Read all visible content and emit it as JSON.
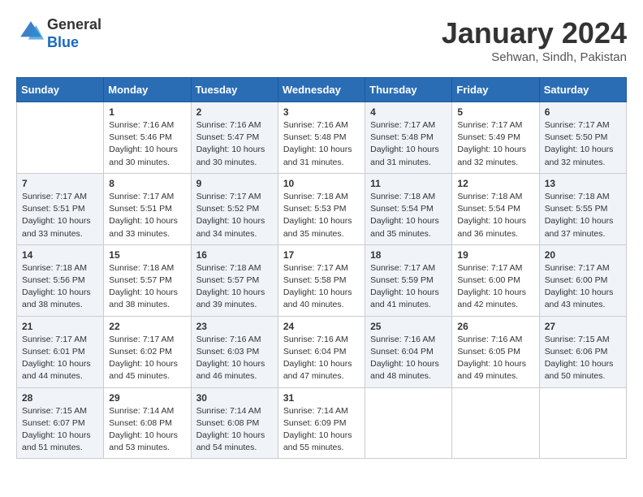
{
  "header": {
    "logo_general": "General",
    "logo_blue": "Blue",
    "month_year": "January 2024",
    "location": "Sehwan, Sindh, Pakistan"
  },
  "days_of_week": [
    "Sunday",
    "Monday",
    "Tuesday",
    "Wednesday",
    "Thursday",
    "Friday",
    "Saturday"
  ],
  "weeks": [
    [
      {
        "day": "",
        "info": ""
      },
      {
        "day": "1",
        "info": "Sunrise: 7:16 AM\nSunset: 5:46 PM\nDaylight: 10 hours\nand 30 minutes."
      },
      {
        "day": "2",
        "info": "Sunrise: 7:16 AM\nSunset: 5:47 PM\nDaylight: 10 hours\nand 30 minutes."
      },
      {
        "day": "3",
        "info": "Sunrise: 7:16 AM\nSunset: 5:48 PM\nDaylight: 10 hours\nand 31 minutes."
      },
      {
        "day": "4",
        "info": "Sunrise: 7:17 AM\nSunset: 5:48 PM\nDaylight: 10 hours\nand 31 minutes."
      },
      {
        "day": "5",
        "info": "Sunrise: 7:17 AM\nSunset: 5:49 PM\nDaylight: 10 hours\nand 32 minutes."
      },
      {
        "day": "6",
        "info": "Sunrise: 7:17 AM\nSunset: 5:50 PM\nDaylight: 10 hours\nand 32 minutes."
      }
    ],
    [
      {
        "day": "7",
        "info": "Sunrise: 7:17 AM\nSunset: 5:51 PM\nDaylight: 10 hours\nand 33 minutes."
      },
      {
        "day": "8",
        "info": "Sunrise: 7:17 AM\nSunset: 5:51 PM\nDaylight: 10 hours\nand 33 minutes."
      },
      {
        "day": "9",
        "info": "Sunrise: 7:17 AM\nSunset: 5:52 PM\nDaylight: 10 hours\nand 34 minutes."
      },
      {
        "day": "10",
        "info": "Sunrise: 7:18 AM\nSunset: 5:53 PM\nDaylight: 10 hours\nand 35 minutes."
      },
      {
        "day": "11",
        "info": "Sunrise: 7:18 AM\nSunset: 5:54 PM\nDaylight: 10 hours\nand 35 minutes."
      },
      {
        "day": "12",
        "info": "Sunrise: 7:18 AM\nSunset: 5:54 PM\nDaylight: 10 hours\nand 36 minutes."
      },
      {
        "day": "13",
        "info": "Sunrise: 7:18 AM\nSunset: 5:55 PM\nDaylight: 10 hours\nand 37 minutes."
      }
    ],
    [
      {
        "day": "14",
        "info": "Sunrise: 7:18 AM\nSunset: 5:56 PM\nDaylight: 10 hours\nand 38 minutes."
      },
      {
        "day": "15",
        "info": "Sunrise: 7:18 AM\nSunset: 5:57 PM\nDaylight: 10 hours\nand 38 minutes."
      },
      {
        "day": "16",
        "info": "Sunrise: 7:18 AM\nSunset: 5:57 PM\nDaylight: 10 hours\nand 39 minutes."
      },
      {
        "day": "17",
        "info": "Sunrise: 7:17 AM\nSunset: 5:58 PM\nDaylight: 10 hours\nand 40 minutes."
      },
      {
        "day": "18",
        "info": "Sunrise: 7:17 AM\nSunset: 5:59 PM\nDaylight: 10 hours\nand 41 minutes."
      },
      {
        "day": "19",
        "info": "Sunrise: 7:17 AM\nSunset: 6:00 PM\nDaylight: 10 hours\nand 42 minutes."
      },
      {
        "day": "20",
        "info": "Sunrise: 7:17 AM\nSunset: 6:00 PM\nDaylight: 10 hours\nand 43 minutes."
      }
    ],
    [
      {
        "day": "21",
        "info": "Sunrise: 7:17 AM\nSunset: 6:01 PM\nDaylight: 10 hours\nand 44 minutes."
      },
      {
        "day": "22",
        "info": "Sunrise: 7:17 AM\nSunset: 6:02 PM\nDaylight: 10 hours\nand 45 minutes."
      },
      {
        "day": "23",
        "info": "Sunrise: 7:16 AM\nSunset: 6:03 PM\nDaylight: 10 hours\nand 46 minutes."
      },
      {
        "day": "24",
        "info": "Sunrise: 7:16 AM\nSunset: 6:04 PM\nDaylight: 10 hours\nand 47 minutes."
      },
      {
        "day": "25",
        "info": "Sunrise: 7:16 AM\nSunset: 6:04 PM\nDaylight: 10 hours\nand 48 minutes."
      },
      {
        "day": "26",
        "info": "Sunrise: 7:16 AM\nSunset: 6:05 PM\nDaylight: 10 hours\nand 49 minutes."
      },
      {
        "day": "27",
        "info": "Sunrise: 7:15 AM\nSunset: 6:06 PM\nDaylight: 10 hours\nand 50 minutes."
      }
    ],
    [
      {
        "day": "28",
        "info": "Sunrise: 7:15 AM\nSunset: 6:07 PM\nDaylight: 10 hours\nand 51 minutes."
      },
      {
        "day": "29",
        "info": "Sunrise: 7:14 AM\nSunset: 6:08 PM\nDaylight: 10 hours\nand 53 minutes."
      },
      {
        "day": "30",
        "info": "Sunrise: 7:14 AM\nSunset: 6:08 PM\nDaylight: 10 hours\nand 54 minutes."
      },
      {
        "day": "31",
        "info": "Sunrise: 7:14 AM\nSunset: 6:09 PM\nDaylight: 10 hours\nand 55 minutes."
      },
      {
        "day": "",
        "info": ""
      },
      {
        "day": "",
        "info": ""
      },
      {
        "day": "",
        "info": ""
      }
    ]
  ]
}
